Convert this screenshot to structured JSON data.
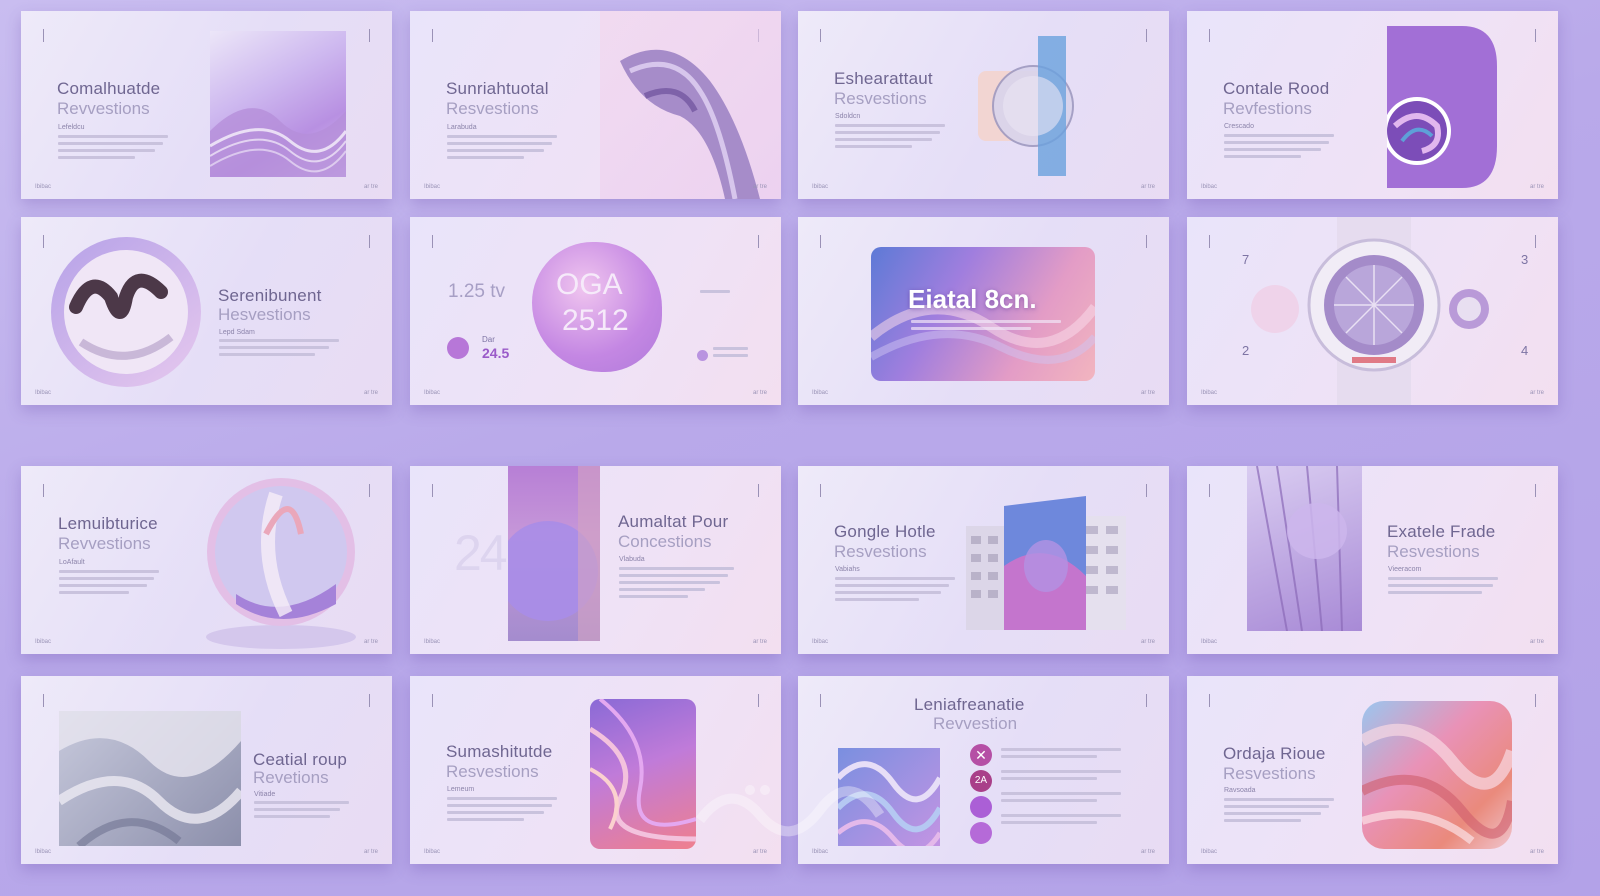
{
  "slides": [
    {
      "title": "Comalhuatde",
      "subtitle": "Revvestions",
      "label": "Lefeldcu"
    },
    {
      "title": "Sunriahtuotal",
      "subtitle": "Resvestions",
      "label": "Larabuda"
    },
    {
      "title": "Eshearattaut",
      "subtitle": "Resvestions",
      "label": "Sdoldcn"
    },
    {
      "title": "Contale Rood",
      "subtitle": "Revfestions",
      "label": "Crescado"
    },
    {
      "title": "Serenibunent",
      "subtitle": "Hesvestions",
      "label": "Lepd Sdam"
    },
    {
      "num1": "1.25 tv",
      "num2": "Dar",
      "num3": "24.5",
      "badge_line1": "OGA",
      "badge_line2": "2512"
    },
    {
      "title": "Eiatal 8cn."
    },
    {
      "tick_tl": "7",
      "tick_bl": "2",
      "tick_tr": "3",
      "tick_br": "4"
    },
    {
      "title": "Lemuibturice",
      "subtitle": "Revvestions",
      "label": "LoAfault"
    },
    {
      "title": "Aumaltat Pour",
      "subtitle": "Concestions",
      "label": "Vlabuda",
      "deco": "2415"
    },
    {
      "title": "Gongle Hotle",
      "subtitle": "Resvestions",
      "label": "Vabiahs"
    },
    {
      "title": "Exatele Frade",
      "subtitle": "Resvestions",
      "label": "Vieeracom"
    },
    {
      "title": "Ceatial roup",
      "subtitle": "Revetions",
      "label": "Vitiade"
    },
    {
      "title": "Sumashitutde",
      "subtitle": "Resvestions",
      "label": "Lemeum"
    },
    {
      "title": "Leniafreanatie",
      "subtitle": "Revvestion",
      "icon_text": "2A"
    },
    {
      "title": "Ordaja Rioue",
      "subtitle": "Resvestions",
      "label": "Ravsoada"
    }
  ],
  "footer": {
    "left": "Ibibac",
    "right": "ar tre"
  },
  "colors": {
    "background": "#b9a9ea",
    "accent_purple": "#a271d9",
    "accent_pink": "#e59bc6",
    "text": "#6f6691"
  }
}
